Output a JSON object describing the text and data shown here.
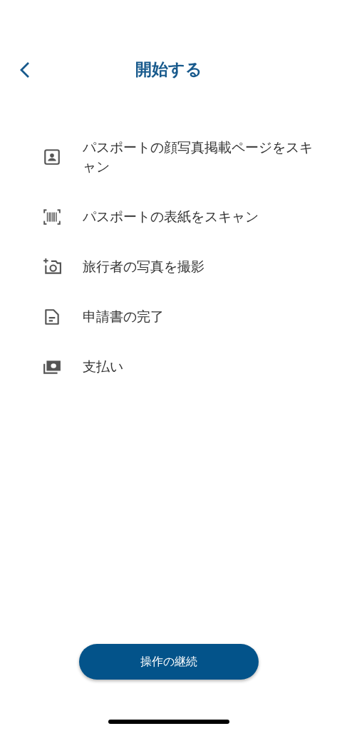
{
  "header": {
    "title": "開始する"
  },
  "steps": [
    {
      "kind": "id-photo",
      "label": "パスポートの顔写真掲載ページをスキャン"
    },
    {
      "kind": "barcode",
      "label": "パスポートの表紙をスキャン"
    },
    {
      "kind": "camera",
      "label": "旅行者の写真を撮影"
    },
    {
      "kind": "document",
      "label": "申請書の完了"
    },
    {
      "kind": "money",
      "label": "支払い"
    }
  ],
  "continue_button": {
    "label": "操作の継続"
  }
}
